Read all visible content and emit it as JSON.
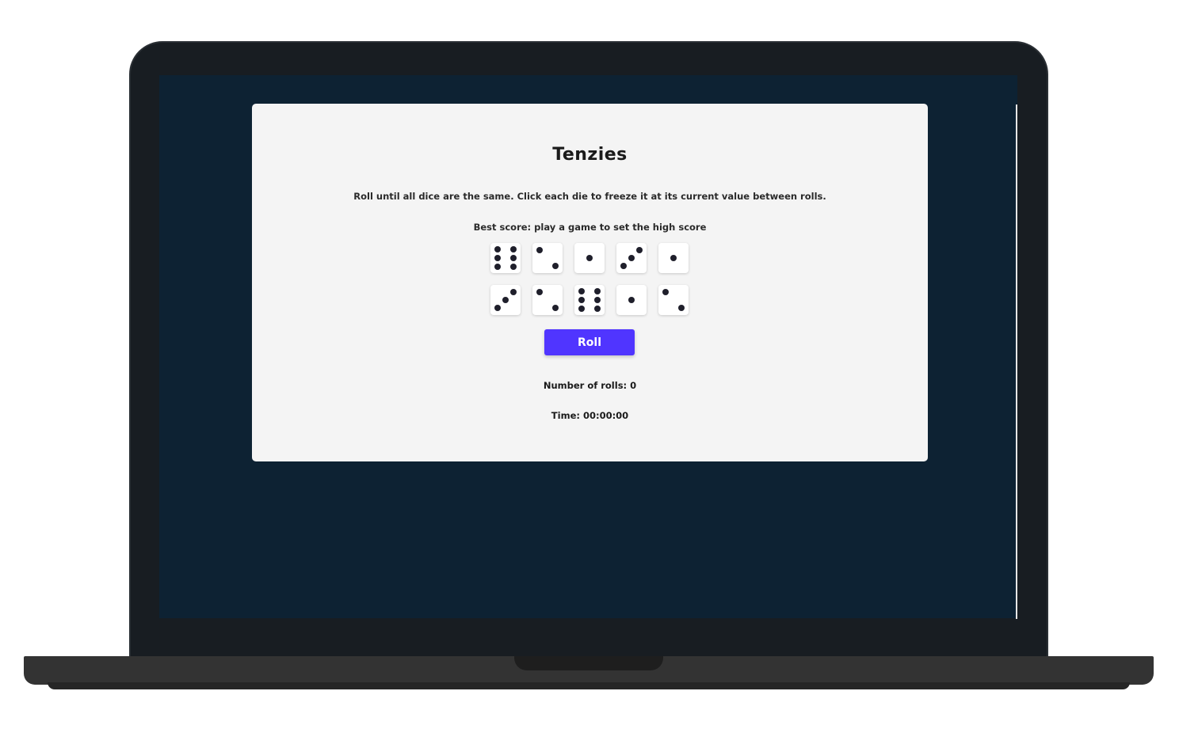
{
  "game": {
    "title": "Tenzies",
    "instructions": "Roll until all dice are the same. Click each die to freeze it at its current value between rolls.",
    "best_score": "Best score: play a game to set the high score",
    "dice": [
      6,
      2,
      1,
      3,
      1,
      3,
      2,
      6,
      1,
      2
    ],
    "roll_label": "Roll",
    "rolls_text": "Number of rolls: 0",
    "time_text": "Time: 00:00:00"
  },
  "colors": {
    "screen_background": "#0d2233",
    "card_background": "#f4f4f4",
    "accent": "#5035ff",
    "pip": "#1f1f2b"
  }
}
